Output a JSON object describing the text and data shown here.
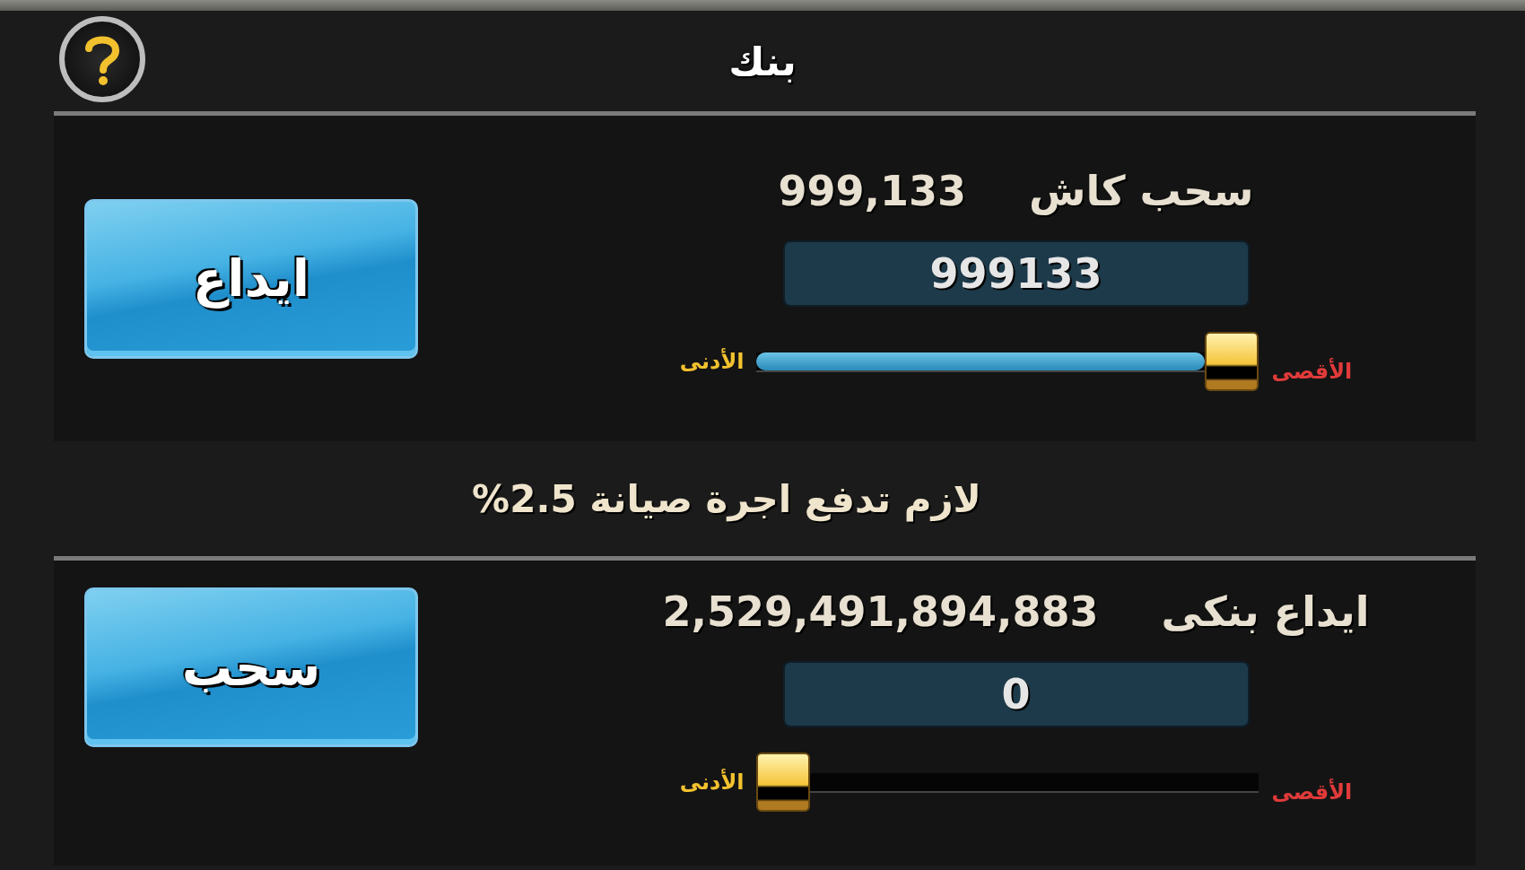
{
  "title": "بنك",
  "sections": [
    {
      "label": "سحب كاش",
      "amount": "999,133",
      "field_value": "999133",
      "min_label": "الأدنى",
      "max_label": "الأقصى",
      "level": 1,
      "button": "ايداع"
    },
    {
      "label": "ايداع بنكى",
      "amount": "2,529,491,894,883",
      "field_value": "0",
      "min_label": "الأدنى",
      "max_label": "الأقصى",
      "level": 0,
      "button": "سحب"
    }
  ],
  "note": "لازم تدفع اجرة صيانة 2.5%"
}
